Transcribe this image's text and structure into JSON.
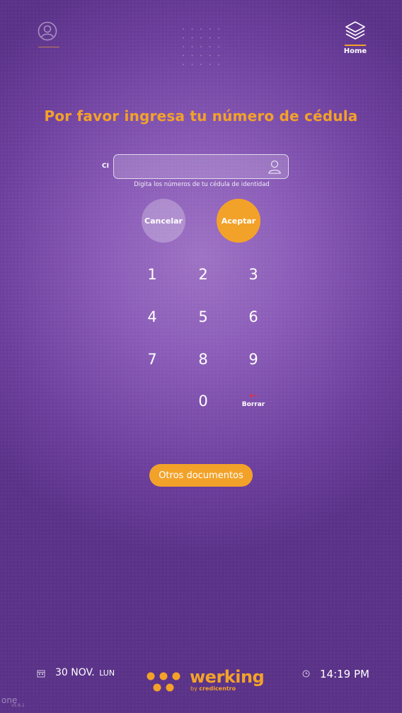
{
  "header": {
    "user_icon": "user-circle-icon",
    "grid_icon": "dot-grid-icon",
    "home_icon": "layers-stack-icon",
    "home_label": "Home"
  },
  "main": {
    "title": "Por favor ingresa tu número de cédula",
    "id_field": {
      "label": "CI",
      "value": "",
      "icon": "user-outline-icon",
      "hint": "Digita los números de tu cédula de identidad"
    },
    "cancel_label": "Cancelar",
    "accept_label": "Aceptar",
    "keypad": {
      "keys": [
        "1",
        "2",
        "3",
        "4",
        "5",
        "6",
        "7",
        "8",
        "9",
        "0"
      ],
      "delete_icon": "arrow-left-icon",
      "delete_label": "Borrar"
    },
    "other_docs_label": "Otros documentos"
  },
  "footer": {
    "date": "30 NOV.",
    "weekday": "LUN",
    "date_icon": "calendar-icon",
    "brand": "werking",
    "brand_sub_prefix": "by",
    "brand_sub_name": "credicentro",
    "time_icon": "clock-icon",
    "time": "14:19 PM",
    "version_logo": "one",
    "version": "v5.6.1"
  },
  "colors": {
    "accent": "#f3a229",
    "background": "#7a4aaa",
    "delete_arrow": "#d8324a"
  }
}
